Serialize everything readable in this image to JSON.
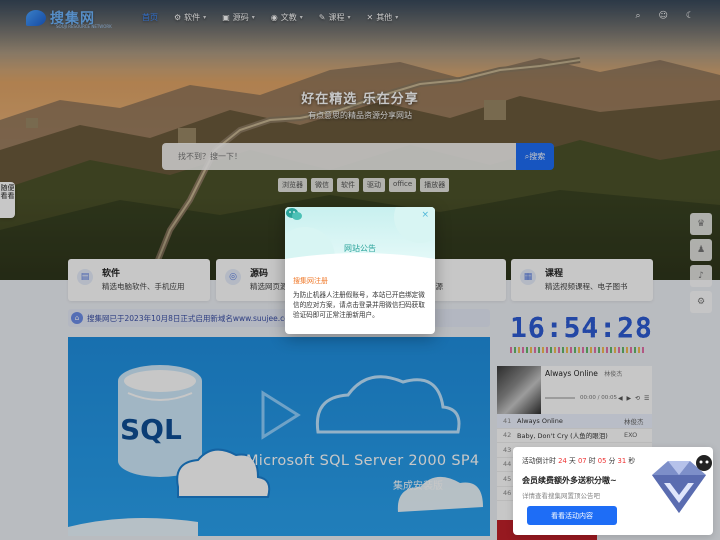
{
  "nav": {
    "logo_text": "搜集网",
    "logo_sub": "SOUJI RESOURCE NETWORK",
    "items": [
      {
        "label": "首页",
        "icon": "home-icon"
      },
      {
        "label": "软件",
        "icon": "apps-icon"
      },
      {
        "label": "源码",
        "icon": "code-icon"
      },
      {
        "label": "文教",
        "icon": "book-icon"
      },
      {
        "label": "课程",
        "icon": "course-icon"
      },
      {
        "label": "其他",
        "icon": "grid-icon"
      }
    ],
    "right_icons": [
      "search-icon",
      "user-icon",
      "moon-icon"
    ]
  },
  "hero": {
    "title": "好在精选 乐在分享",
    "subtitle": "有点意思的精品资源分享网站",
    "search_placeholder": "找不到？搜一下！",
    "search_button": "搜索",
    "tags": [
      "浏览器",
      "微信",
      "软件",
      "驱动",
      "office",
      "播放器"
    ]
  },
  "side_tab": {
    "label": "随便看看"
  },
  "cards": [
    {
      "title": "软件",
      "desc": "精选电脑软件、手机应用",
      "icon": "app-icon"
    },
    {
      "title": "源码",
      "desc": "精选网页源码",
      "icon": "code-icon"
    },
    {
      "title": "文教",
      "desc": "精选相关资源",
      "icon": "book-icon"
    },
    {
      "title": "课程",
      "desc": "精选视频课程、电子图书",
      "icon": "course-icon"
    }
  ],
  "notice": {
    "text": "搜集网已于2023年10月8日正式启用新域名www.suujee.com。"
  },
  "banner": {
    "sql": "SQL",
    "title": "Microsoft SQL Server 2000 SP4",
    "subtitle": "集成安装版"
  },
  "clock": {
    "time": "16:54:28"
  },
  "player": {
    "song": "Always Online",
    "artist": "林俊杰",
    "time": "00:00 / 00:05",
    "controls": "◀ ▶ ⟲ ☰"
  },
  "playlist": [
    {
      "num": "41",
      "name": "Always Online",
      "artist": "林俊杰",
      "current": true
    },
    {
      "num": "42",
      "name": "Baby, Don't Cry (人鱼的眼泪)",
      "artist": "EXO",
      "current": false
    },
    {
      "num": "43",
      "name": "",
      "artist": "",
      "current": false
    },
    {
      "num": "44",
      "name": "",
      "artist": "",
      "current": false
    },
    {
      "num": "45",
      "name": "",
      "artist": "",
      "current": false
    },
    {
      "num": "46",
      "name": "",
      "artist": "",
      "current": false
    }
  ],
  "promo": {
    "countdown_label": "活动倒计时",
    "days": "24",
    "days_unit": "天",
    "hours": "07",
    "hours_unit": "时",
    "minutes": "05",
    "minutes_unit": "分",
    "seconds": "31",
    "seconds_unit": "秒",
    "title": "会员续费额外多送积分嗷~",
    "desc": "详情查看搜集网置顶公告吧",
    "button": "看看活动内容"
  },
  "modal": {
    "title": "网站公告",
    "subtitle": "搜集网注册",
    "body": "为防止机器人注册假账号，本站已开启绑定微信的应对方案，请点击登录并用微信扫码获取验证码即可正常注册新用户。",
    "close": "×"
  },
  "colors": {
    "accent": "#1e6df6",
    "modal_title": "#2aa39a",
    "warning": "#f07a2b"
  }
}
